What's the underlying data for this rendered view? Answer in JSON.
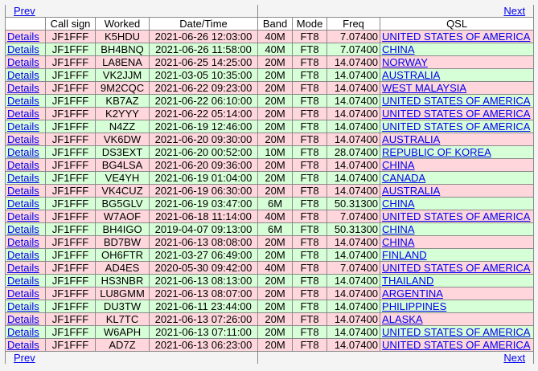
{
  "nav": {
    "prev": "Prev",
    "next": "Next"
  },
  "headers": [
    "",
    "Call sign",
    "Worked",
    "Date/Time",
    "Band",
    "Mode",
    "Freq",
    "QSL"
  ],
  "details_label": "Details",
  "colors": {
    "row_pink": "#ffd6dc",
    "row_green": "#d7ffd7",
    "link": "#0000ee"
  },
  "rows": [
    {
      "call": "JF1FFF",
      "worked": "K5HDU",
      "datetime": "2021-06-26 12:03:00",
      "band": "40M",
      "mode": "FT8",
      "freq": "7.07400",
      "qsl": "UNITED STATES OF AMERICA",
      "color": "pink"
    },
    {
      "call": "JF1FFF",
      "worked": "BH4BNQ",
      "datetime": "2021-06-26 11:58:00",
      "band": "40M",
      "mode": "FT8",
      "freq": "7.07400",
      "qsl": "CHINA",
      "color": "green"
    },
    {
      "call": "JF1FFF",
      "worked": "LA8ENA",
      "datetime": "2021-06-25 14:25:00",
      "band": "20M",
      "mode": "FT8",
      "freq": "14.07400",
      "qsl": "NORWAY",
      "color": "pink"
    },
    {
      "call": "JF1FFF",
      "worked": "VK2JJM",
      "datetime": "2021-03-05 10:35:00",
      "band": "20M",
      "mode": "FT8",
      "freq": "14.07400",
      "qsl": "AUSTRALIA",
      "color": "green"
    },
    {
      "call": "JF1FFF",
      "worked": "9M2CQC",
      "datetime": "2021-06-22 09:23:00",
      "band": "20M",
      "mode": "FT8",
      "freq": "14.07400",
      "qsl": "WEST MALAYSIA",
      "color": "pink"
    },
    {
      "call": "JF1FFF",
      "worked": "KB7AZ",
      "datetime": "2021-06-22 06:10:00",
      "band": "20M",
      "mode": "FT8",
      "freq": "14.07400",
      "qsl": "UNITED STATES OF AMERICA",
      "color": "green"
    },
    {
      "call": "JF1FFF",
      "worked": "K2YYY",
      "datetime": "2021-06-22 05:14:00",
      "band": "20M",
      "mode": "FT8",
      "freq": "14.07400",
      "qsl": "UNITED STATES OF AMERICA",
      "color": "pink"
    },
    {
      "call": "JF1FFF",
      "worked": "N4ZZ",
      "datetime": "2021-06-19 12:46:00",
      "band": "20M",
      "mode": "FT8",
      "freq": "14.07400",
      "qsl": "UNITED STATES OF AMERICA",
      "color": "green"
    },
    {
      "call": "JF1FFF",
      "worked": "VK6DW",
      "datetime": "2021-06-20 09:30:00",
      "band": "20M",
      "mode": "FT8",
      "freq": "14.07400",
      "qsl": "AUSTRALIA",
      "color": "pink"
    },
    {
      "call": "JF1FFF",
      "worked": "DS3EXT",
      "datetime": "2021-06-20 00:52:00",
      "band": "10M",
      "mode": "FT8",
      "freq": "28.07400",
      "qsl": "REPUBLIC OF KOREA",
      "color": "green"
    },
    {
      "call": "JF1FFF",
      "worked": "BG4LSA",
      "datetime": "2021-06-20 09:36:00",
      "band": "20M",
      "mode": "FT8",
      "freq": "14.07400",
      "qsl": "CHINA",
      "color": "pink"
    },
    {
      "call": "JF1FFF",
      "worked": "VE4YH",
      "datetime": "2021-06-19 01:04:00",
      "band": "20M",
      "mode": "FT8",
      "freq": "14.07400",
      "qsl": "CANADA",
      "color": "green"
    },
    {
      "call": "JF1FFF",
      "worked": "VK4CUZ",
      "datetime": "2021-06-19 06:30:00",
      "band": "20M",
      "mode": "FT8",
      "freq": "14.07400",
      "qsl": "AUSTRALIA",
      "color": "pink"
    },
    {
      "call": "JF1FFF",
      "worked": "BG5GLV",
      "datetime": "2021-06-19 03:47:00",
      "band": "6M",
      "mode": "FT8",
      "freq": "50.31300",
      "qsl": "CHINA",
      "color": "green"
    },
    {
      "call": "JF1FFF",
      "worked": "W7AOF",
      "datetime": "2021-06-18 11:14:00",
      "band": "40M",
      "mode": "FT8",
      "freq": "7.07400",
      "qsl": "UNITED STATES OF AMERICA",
      "color": "pink"
    },
    {
      "call": "JF1FFF",
      "worked": "BH4IGO",
      "datetime": "2019-04-07 09:13:00",
      "band": "6M",
      "mode": "FT8",
      "freq": "50.31300",
      "qsl": "CHINA",
      "color": "green"
    },
    {
      "call": "JF1FFF",
      "worked": "BD7BW",
      "datetime": "2021-06-13 08:08:00",
      "band": "20M",
      "mode": "FT8",
      "freq": "14.07400",
      "qsl": "CHINA",
      "color": "pink"
    },
    {
      "call": "JF1FFF",
      "worked": "OH6FTR",
      "datetime": "2021-03-27 06:49:00",
      "band": "20M",
      "mode": "FT8",
      "freq": "14.07400",
      "qsl": "FINLAND",
      "color": "green"
    },
    {
      "call": "JF1FFF",
      "worked": "AD4ES",
      "datetime": "2020-05-30 09:42:00",
      "band": "40M",
      "mode": "FT8",
      "freq": "7.07400",
      "qsl": "UNITED STATES OF AMERICA",
      "color": "pink"
    },
    {
      "call": "JF1FFF",
      "worked": "HS3NBR",
      "datetime": "2021-06-13 08:13:00",
      "band": "20M",
      "mode": "FT8",
      "freq": "14.07400",
      "qsl": "THAILAND",
      "color": "green"
    },
    {
      "call": "JF1FFF",
      "worked": "LU8GMM",
      "datetime": "2021-06-13 08:07:00",
      "band": "20M",
      "mode": "FT8",
      "freq": "14.07400",
      "qsl": "ARGENTINA",
      "color": "pink"
    },
    {
      "call": "JF1FFF",
      "worked": "DU3TW",
      "datetime": "2021-06-11 23:44:00",
      "band": "20M",
      "mode": "FT8",
      "freq": "14.07400",
      "qsl": "PHILIPPINES",
      "color": "green"
    },
    {
      "call": "JF1FFF",
      "worked": "KL7TC",
      "datetime": "2021-06-13 07:26:00",
      "band": "20M",
      "mode": "FT8",
      "freq": "14.07400",
      "qsl": "ALASKA",
      "color": "pink"
    },
    {
      "call": "JF1FFF",
      "worked": "W6APH",
      "datetime": "2021-06-13 07:11:00",
      "band": "20M",
      "mode": "FT8",
      "freq": "14.07400",
      "qsl": "UNITED STATES OF AMERICA",
      "color": "green"
    },
    {
      "call": "JF1FFF",
      "worked": "AD7Z",
      "datetime": "2021-06-13 06:23:00",
      "band": "20M",
      "mode": "FT8",
      "freq": "14.07400",
      "qsl": "UNITED STATES OF AMERICA",
      "color": "pink"
    }
  ]
}
